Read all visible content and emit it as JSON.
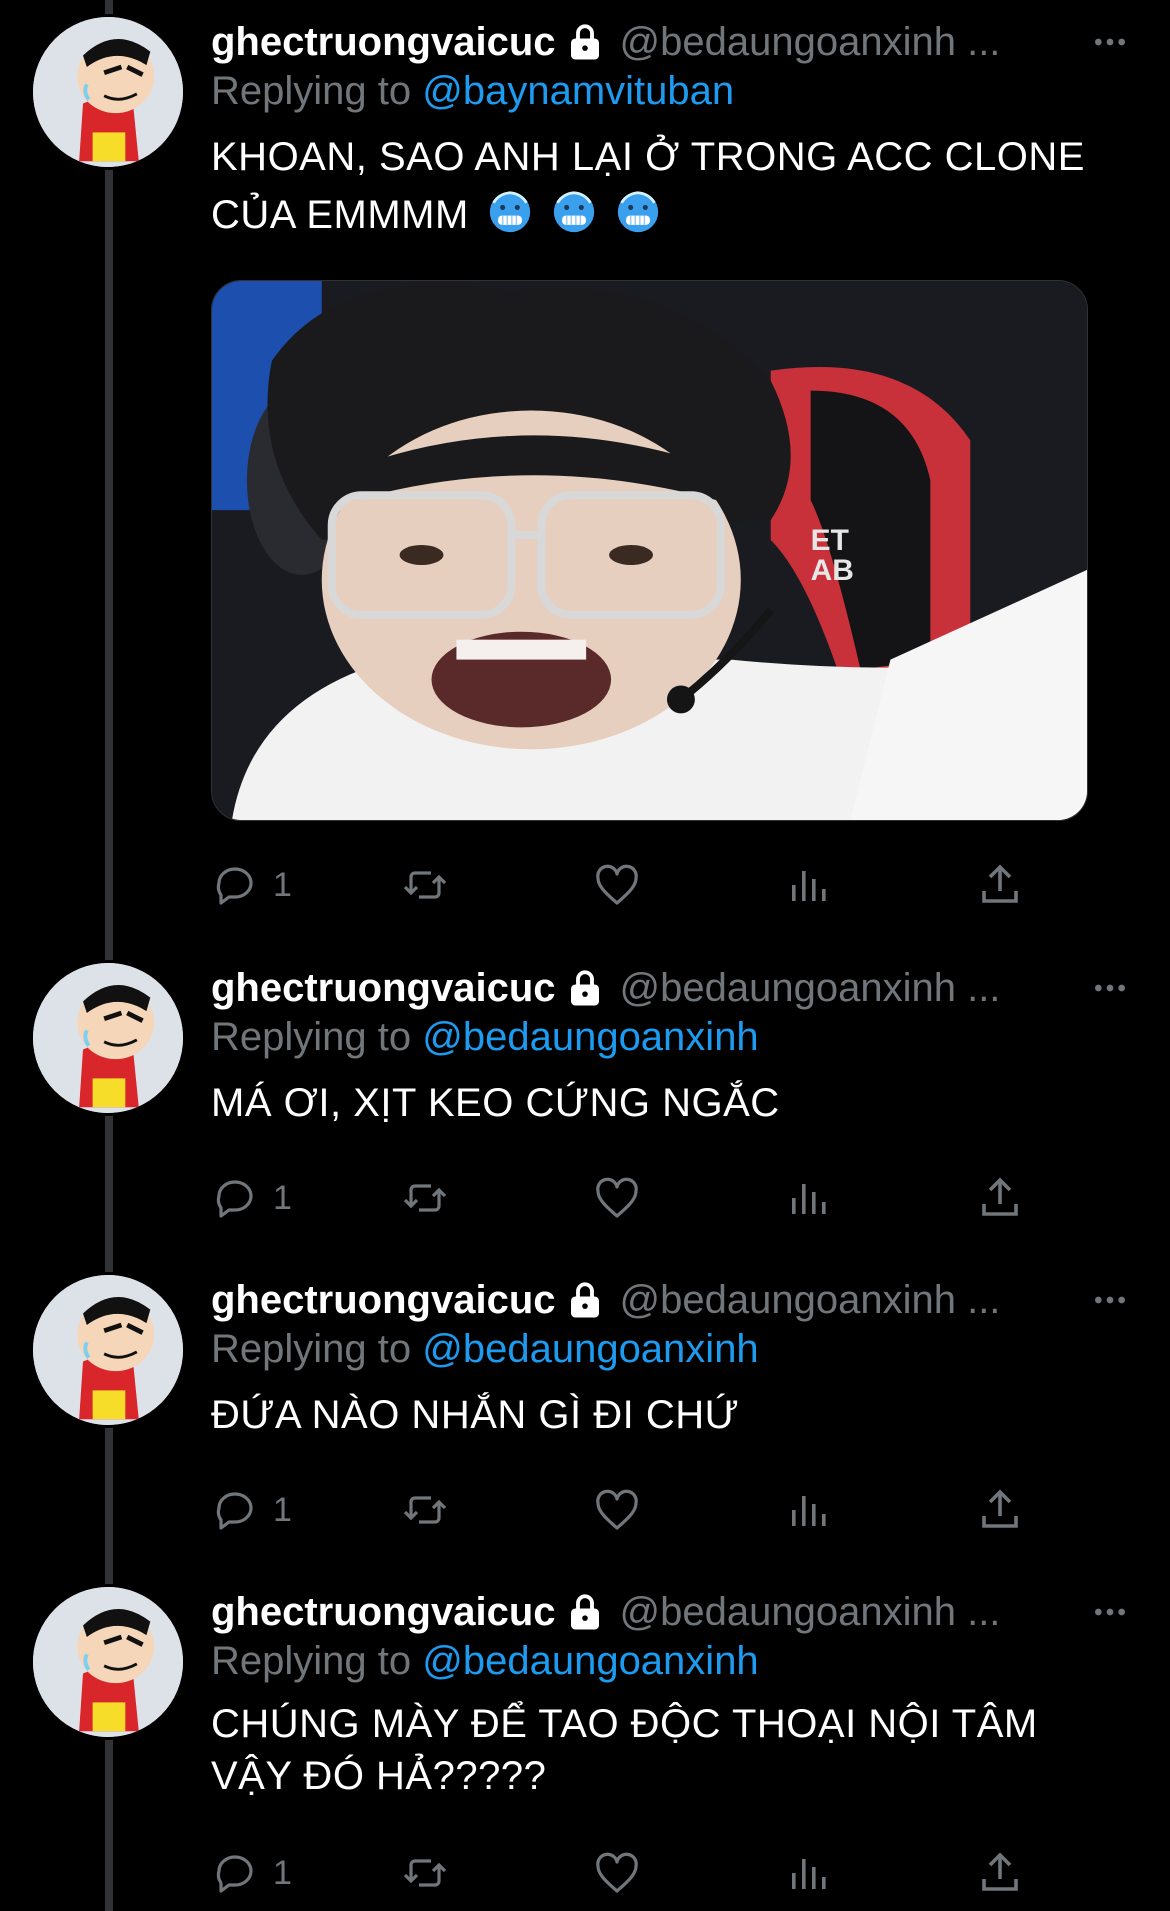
{
  "colors": {
    "background": "#000000",
    "text": "#ffffff",
    "muted": "#71767b",
    "link": "#1d9bf0",
    "thread_line": "#2f3336"
  },
  "tweets": [
    {
      "display_name": "ghectruongvaicuc",
      "handle": "@bedaungoanxinh ...",
      "replying_label": "Replying to ",
      "replying_to": "@baynamvituban",
      "text": "KHOAN, SAO ANH LẠI Ở TRONG ACC CLONE CỦA EMMMM",
      "emojis": [
        "cold-face-emoji",
        "cold-face-emoji",
        "cold-face-emoji"
      ],
      "has_media": true,
      "reply_count": "1"
    },
    {
      "display_name": "ghectruongvaicuc",
      "handle": "@bedaungoanxinh ...",
      "replying_label": "Replying to ",
      "replying_to": "@bedaungoanxinh",
      "text": "MÁ ƠI, XỊT KEO CỨNG NGẮC",
      "reply_count": "1"
    },
    {
      "display_name": "ghectruongvaicuc",
      "handle": "@bedaungoanxinh ...",
      "replying_label": "Replying to ",
      "replying_to": "@bedaungoanxinh",
      "text": "ĐỨA NÀO NHẮN GÌ ĐI CHỨ",
      "reply_count": "1"
    },
    {
      "display_name": "ghectruongvaicuc",
      "handle": "@bedaungoanxinh ...",
      "replying_label": "Replying to ",
      "replying_to": "@bedaungoanxinh",
      "text": "CHÚNG MÀY ĐỂ TAO ĐỘC THOẠI NỘI TÂM VẬY ĐÓ HẢ?????",
      "reply_count": "1"
    }
  ],
  "icons": {
    "lock": "lock-icon",
    "more": "more-icon",
    "reply": "reply-icon",
    "retweet": "retweet-icon",
    "like": "heart-icon",
    "views": "analytics-icon",
    "share": "share-icon"
  }
}
